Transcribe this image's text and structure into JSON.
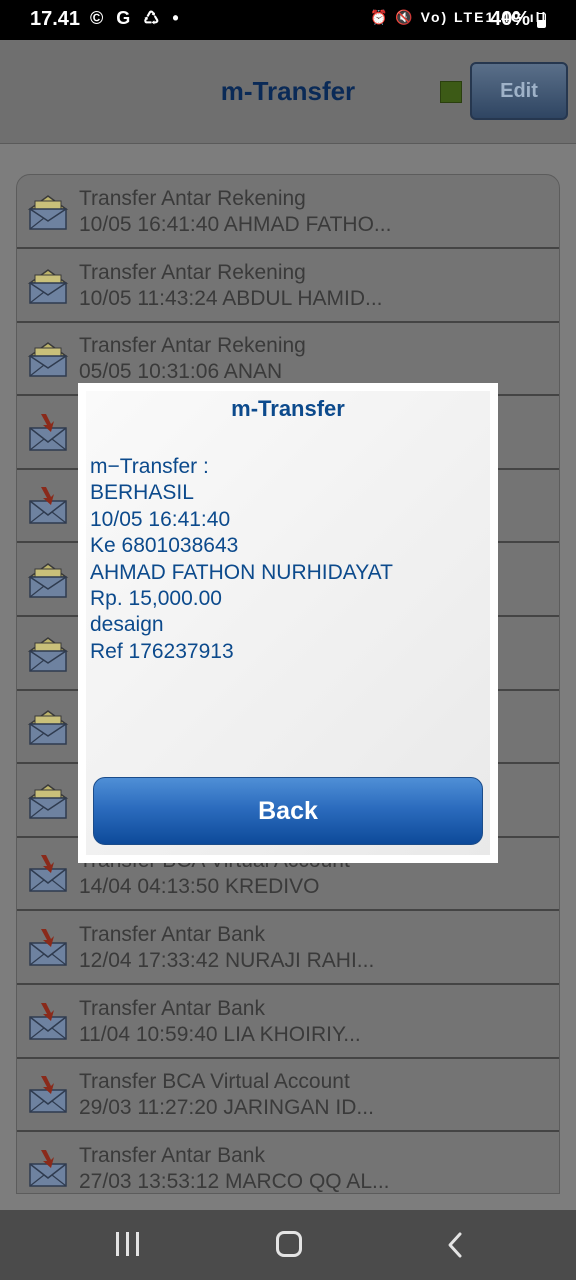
{
  "status_bar": {
    "time": "17.41",
    "left_icons": "© G ♺ •",
    "right_icons": "⏰ 🔇 Vo) LTE1 4G ıll",
    "battery": "40%"
  },
  "header": {
    "title": "m-Transfer",
    "edit_label": "Edit",
    "status_color": "#3c5a16"
  },
  "colors": {
    "accent": "#0c4a8c",
    "button": "#2c6cbe"
  },
  "transactions": [
    {
      "title": "Transfer Antar Rekening",
      "subtitle": "10/05 16:41:40 AHMAD FATHO...",
      "status": "read",
      "icon": "envelope-open-icon"
    },
    {
      "title": "Transfer Antar Rekening",
      "subtitle": "10/05 11:43:24 ABDUL HAMID...",
      "status": "read",
      "icon": "envelope-open-icon"
    },
    {
      "title": "Transfer Antar Rekening",
      "subtitle": "05/05 10:31:06 ANAN",
      "status": "read",
      "icon": "envelope-open-icon"
    },
    {
      "title": "",
      "subtitle": "",
      "status": "unread",
      "icon": "envelope-alert-icon"
    },
    {
      "title": "",
      "subtitle": "",
      "status": "unread",
      "icon": "envelope-alert-icon"
    },
    {
      "title": "",
      "subtitle": "",
      "status": "read",
      "icon": "envelope-open-icon"
    },
    {
      "title": "",
      "subtitle": "",
      "status": "read",
      "icon": "envelope-open-icon"
    },
    {
      "title": "",
      "subtitle": "",
      "status": "read",
      "icon": "envelope-open-icon"
    },
    {
      "title": "",
      "subtitle": "",
      "status": "read",
      "icon": "envelope-open-icon"
    },
    {
      "title": "Transfer BCA Virtual Account",
      "subtitle": "14/04 04:13:50 KREDIVO",
      "status": "unread",
      "icon": "envelope-alert-icon"
    },
    {
      "title": "Transfer Antar Bank",
      "subtitle": "12/04 17:33:42 NURAJI RAHI...",
      "status": "unread",
      "icon": "envelope-alert-icon"
    },
    {
      "title": "Transfer Antar Bank",
      "subtitle": "11/04 10:59:40 LIA KHOIRIY...",
      "status": "unread",
      "icon": "envelope-alert-icon"
    },
    {
      "title": "Transfer BCA Virtual Account",
      "subtitle": "29/03 11:27:20 JARINGAN ID...",
      "status": "unread",
      "icon": "envelope-alert-icon"
    },
    {
      "title": "Transfer Antar Bank",
      "subtitle": "27/03 13:53:12 MARCO QQ AL...",
      "status": "unread",
      "icon": "envelope-alert-icon"
    }
  ],
  "dialog": {
    "title": "m-Transfer",
    "lines": [
      "m−Transfer :",
      "BERHASIL",
      "10/05 16:41:40",
      "Ke 6801038643",
      "AHMAD FATHON NURHIDAYAT",
      "Rp. 15,000.00",
      "desaign",
      "Ref 176237913"
    ],
    "back_label": "Back"
  },
  "nav_bar": {
    "recents_icon": "recents-icon",
    "home_icon": "home-icon",
    "back_icon": "back-icon"
  }
}
